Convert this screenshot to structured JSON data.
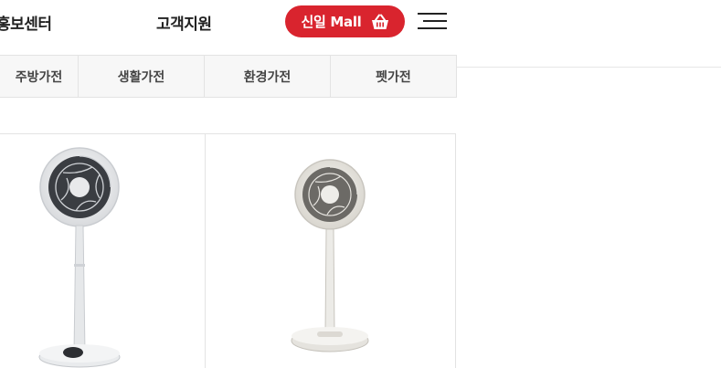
{
  "header": {
    "nav": {
      "promo_center": "홍보센터",
      "customer_support": "고객지원"
    },
    "mall_button": {
      "label": "신일 Mall",
      "icon": "shopping-basket-icon",
      "color": "#d9242e"
    },
    "menu_icon": "hamburger-menu-icon"
  },
  "category_tabs": [
    {
      "label": "주방가전"
    },
    {
      "label": "생활가전"
    },
    {
      "label": "환경가전"
    },
    {
      "label": "펫가전"
    }
  ],
  "products": [
    {
      "image": "circulator-fan-white-product-image"
    },
    {
      "image": "circulator-fan-ivory-product-image"
    }
  ]
}
